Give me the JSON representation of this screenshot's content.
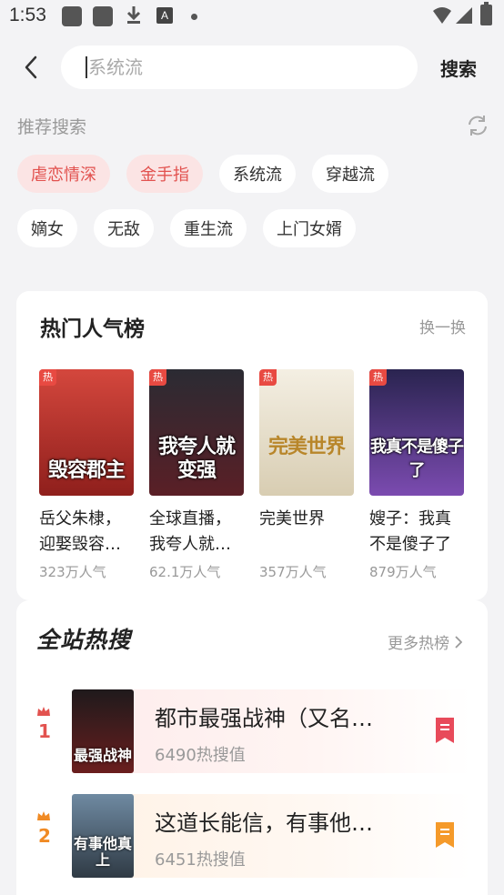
{
  "status_bar": {
    "time": "1:53",
    "icons": [
      "app-notification-icon",
      "app-notification-icon",
      "download-icon",
      "a-icon",
      "dot-icon",
      "wifi-icon",
      "signal-icon",
      "battery-icon"
    ],
    "a_glyph": "A"
  },
  "search": {
    "placeholder": "系统流",
    "button_label": "搜索"
  },
  "recommended": {
    "title": "推荐搜索",
    "tags_row1": [
      {
        "label": "虐恋情深",
        "hot": true
      },
      {
        "label": "金手指",
        "hot": true
      },
      {
        "label": "系统流",
        "hot": false
      },
      {
        "label": "穿越流",
        "hot": false
      }
    ],
    "tags_row2": [
      {
        "label": "嫡女",
        "hot": false
      },
      {
        "label": "无敌",
        "hot": false
      },
      {
        "label": "重生流",
        "hot": false
      },
      {
        "label": "上门女婿",
        "hot": false
      }
    ]
  },
  "popular": {
    "title": "热门人气榜",
    "swap_label": "换一换",
    "books": [
      {
        "title": "岳父朱棣，迎娶毁容…",
        "popularity": "323万人气",
        "badge": "热",
        "cover_text": "毁容郡主",
        "cover_color": "#b5302a"
      },
      {
        "title": "全球直播，我夸人就…",
        "popularity": "62.1万人气",
        "badge": "热",
        "cover_text": "我夸人就变强",
        "cover_color": "#3a2a2e"
      },
      {
        "title": "完美世界",
        "popularity": "357万人气",
        "badge": "热",
        "cover_text": "完美世界",
        "cover_color": "#e9e2cf"
      },
      {
        "title": "嫂子：我真不是傻子了",
        "popularity": "879万人气",
        "badge": "热",
        "cover_text": "我真不是傻子了",
        "cover_color": "#5b3b8a"
      }
    ]
  },
  "hot_search": {
    "title": "全站热搜",
    "more_label": "更多热榜",
    "items": [
      {
        "rank": "1",
        "title": "都市最强战神（又名…",
        "value": "6490热搜值",
        "rank_color": "#e2524f",
        "badge_color": "#e84a5a",
        "cover_text": "最强战神",
        "cover_color": "#3b1e1e"
      },
      {
        "rank": "2",
        "title": "这道长能信，有事他…",
        "value": "6451热搜值",
        "rank_color": "#f08a24",
        "badge_color": "#f59a2a",
        "cover_text": "有事他真上",
        "cover_color": "#4b5a6a"
      }
    ]
  },
  "colors": {
    "hot_tag_bg": "#fbe4e4",
    "hot_tag_text": "#e2524f",
    "background": "#f3f3f5"
  }
}
